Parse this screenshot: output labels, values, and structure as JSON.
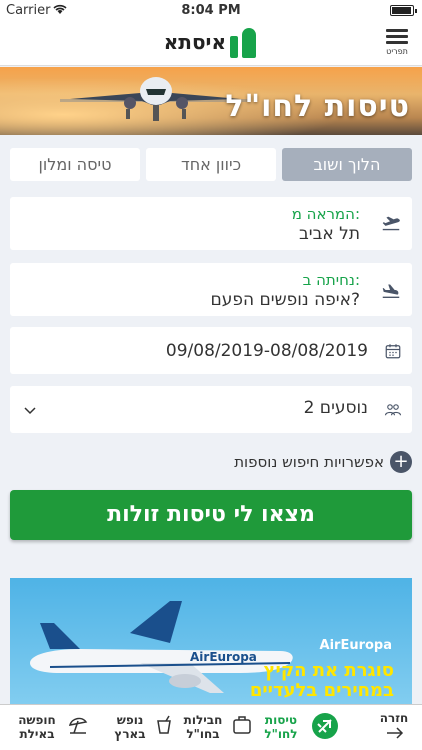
{
  "status": {
    "carrier": "Carrier",
    "time": "8:04 PM"
  },
  "header": {
    "logo_text": "איסתא",
    "menu_label": "תפריט"
  },
  "hero": {
    "title": "טיסות לחו\"ל"
  },
  "tabs": [
    {
      "label": "הלוך ושוב",
      "active": true
    },
    {
      "label": "כיוון אחד",
      "active": false
    },
    {
      "label": "טיסה ומלון",
      "active": false
    }
  ],
  "form": {
    "from": {
      "label": "המראה מ:",
      "value": "תל אביב"
    },
    "to": {
      "label": "נחיתה ב:",
      "placeholder": "איפה נופשים הפעם?"
    },
    "dates": {
      "value": "09/08/2019-08/08/2019"
    },
    "passengers": {
      "value": "2 נוסעים"
    }
  },
  "more_options": "אפשרויות חיפוש נוספות",
  "cta": "מצאו לי טיסות זולות",
  "ad": {
    "brand": "AirEuropa",
    "line1": "סוגרת את הקיץ",
    "line2": "במחירים בלעדיים",
    "plane_text": "AirEuropa"
  },
  "bottom_nav": [
    {
      "id": "back",
      "label": "חזרה"
    },
    {
      "id": "flights",
      "label": "טיסות\nלחו\"ל"
    },
    {
      "id": "packages",
      "label": "חבילות\nבחו\"ל"
    },
    {
      "id": "local",
      "label": "נופש\nבארץ"
    },
    {
      "id": "eilat",
      "label": "חופשה\nבאילת"
    }
  ],
  "colors": {
    "brand_green": "#17a34a",
    "cta_green": "#1f9a3a",
    "active_tab": "#a6afbc"
  }
}
